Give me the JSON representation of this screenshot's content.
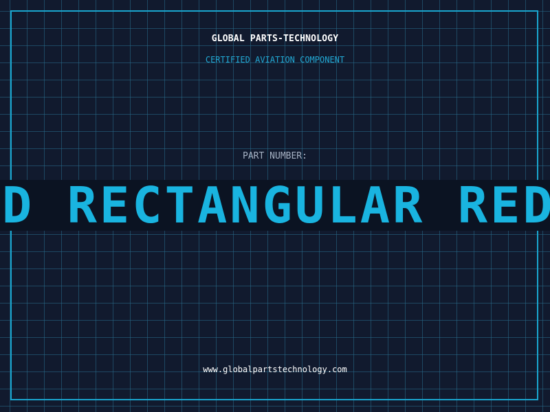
{
  "header": {
    "company": "GLOBAL PARTS-TECHNOLOGY",
    "tagline": "CERTIFIED AVIATION COMPONENT"
  },
  "part": {
    "label": "PART NUMBER:",
    "value": "RECTANGULAR RED RECTANGULAR RED"
  },
  "footer": {
    "url": "www.globalpartstechnology.com"
  },
  "colors": {
    "background": "#111a2e",
    "accent": "#1aa6cf",
    "band": "#0b1322"
  }
}
